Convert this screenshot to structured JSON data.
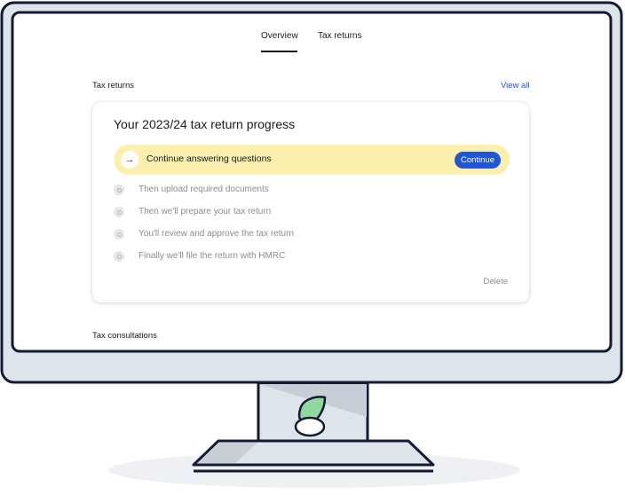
{
  "tabs": [
    {
      "label": "Overview",
      "active": true
    },
    {
      "label": "Tax returns",
      "active": false
    }
  ],
  "tax_returns_section": {
    "title": "Tax returns",
    "view_all": "View all"
  },
  "progress_card": {
    "title": "Your 2023/24 tax return progress",
    "active_step": {
      "label": "Continue answering questions",
      "icon": "arrow-right-icon",
      "button": "Continue"
    },
    "steps": [
      "Then upload required documents",
      "Then we'll prepare your tax return",
      "You'll review and approve the tax return",
      "Finally we'll file the return with HMRC"
    ],
    "delete_label": "Delete"
  },
  "consultations_section": {
    "title": "Tax consultations"
  },
  "colors": {
    "accent": "#1f56d6",
    "highlight": "#fbefad",
    "monitor_bezel": "#dde4ea",
    "logo_green": "#8fd9a0"
  }
}
